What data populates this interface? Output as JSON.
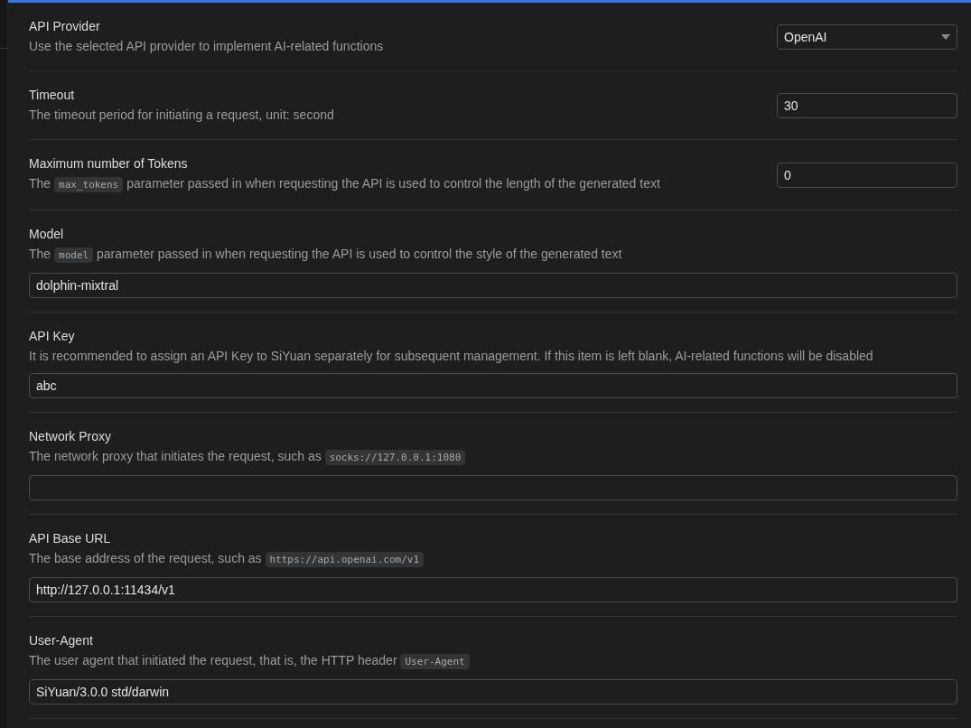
{
  "settings": [
    {
      "kind": "select",
      "title": "API Provider",
      "description": [
        {
          "kind": "text",
          "text": "Use the selected API provider to implement AI-related functions"
        }
      ],
      "value": "OpenAI"
    },
    {
      "kind": "inline-input",
      "title": "Timeout",
      "description": [
        {
          "kind": "text",
          "text": "The timeout period for initiating a request, unit: second"
        }
      ],
      "value": "30"
    },
    {
      "kind": "inline-input",
      "title": "Maximum number of Tokens",
      "description": [
        {
          "kind": "text",
          "text": "The "
        },
        {
          "kind": "code",
          "text": "max_tokens"
        },
        {
          "kind": "text",
          "text": " parameter passed in when requesting the API is used to control the length of the generated text"
        }
      ],
      "value": "0"
    },
    {
      "kind": "block-input",
      "title": "Model",
      "description": [
        {
          "kind": "text",
          "text": "The "
        },
        {
          "kind": "code",
          "text": "model"
        },
        {
          "kind": "text",
          "text": " parameter passed in when requesting the API is used to control the style of the generated text"
        }
      ],
      "value": "dolphin-mixtral"
    },
    {
      "kind": "block-input",
      "title": "API Key",
      "description": [
        {
          "kind": "text",
          "text": "It is recommended to assign an API Key to SiYuan separately for subsequent management. If this item is left blank, AI-related functions will be disabled"
        }
      ],
      "value": "abc"
    },
    {
      "kind": "block-input",
      "title": "Network Proxy",
      "description": [
        {
          "kind": "text",
          "text": "The network proxy that initiates the request, such as "
        },
        {
          "kind": "code",
          "text": "socks://127.0.0.1:1080"
        }
      ]
    },
    {
      "kind": "block-input",
      "title": "API Base URL",
      "description": [
        {
          "kind": "text",
          "text": "The base address of the request, such as "
        },
        {
          "kind": "code",
          "text": "https://api.openai.com/v1"
        }
      ],
      "value": "http://127.0.0.1:11434/v1"
    },
    {
      "kind": "block-input",
      "title": "User-Agent",
      "description": [
        {
          "kind": "text",
          "text": "The user agent that initiated the request, that is, the HTTP header "
        },
        {
          "kind": "code",
          "text": "User-Agent"
        }
      ],
      "value": "SiYuan/3.0.0 std/darwin"
    }
  ]
}
